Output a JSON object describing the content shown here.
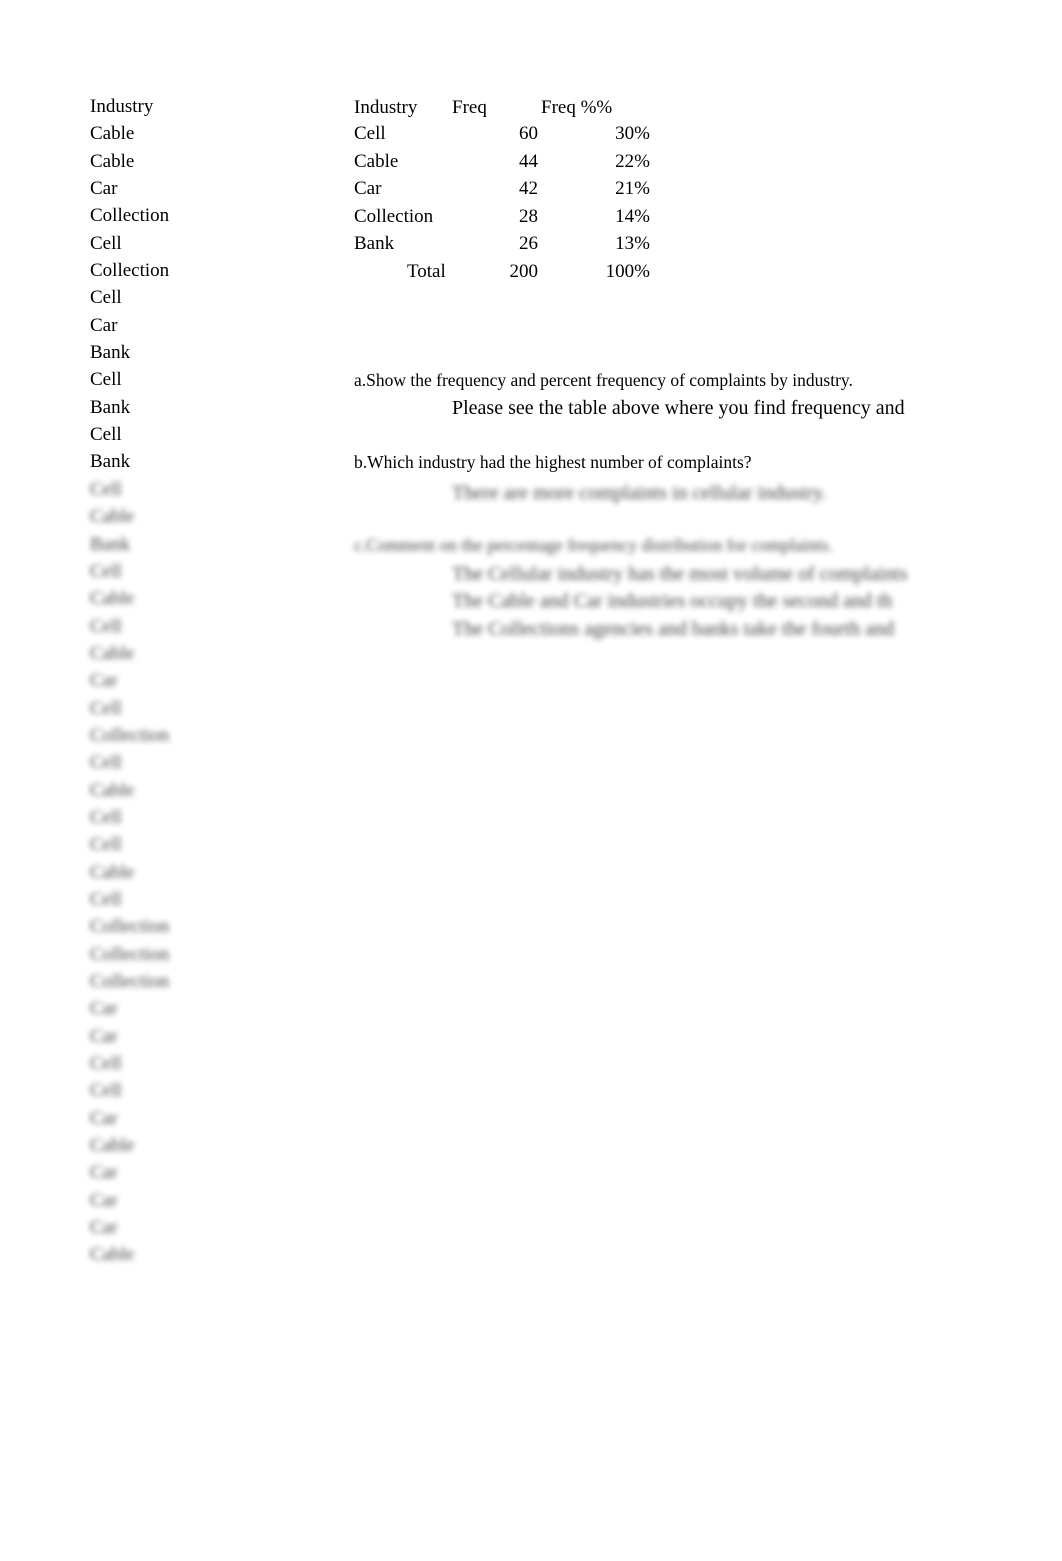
{
  "raw_data": {
    "header": "Industry",
    "visible_items": [
      "Cable",
      "Cable",
      "Car",
      "Collection",
      "Cell",
      "Collection",
      "Cell",
      "Car",
      "Bank",
      "Cell",
      "Bank",
      "Cell",
      "Bank"
    ],
    "blurred_items": [
      "Cell",
      "Cable",
      "Bank",
      "Cell",
      "Cable",
      "Cell",
      "Cable",
      "Car",
      "Cell",
      "Collection",
      "Cell",
      "Cable",
      "Cell",
      "Cell",
      "Cable",
      "Cell",
      "Collection",
      "Collection",
      "Collection",
      "Car",
      "Car",
      "Cell",
      "Cell",
      "Car",
      "Cable",
      "Car",
      "Car",
      "Car",
      "Cable"
    ]
  },
  "freq_table": {
    "headers": {
      "industry": "Industry",
      "freq": "Freq",
      "pct": "Freq %%"
    },
    "rows": [
      {
        "industry": "Cell",
        "freq": "60",
        "pct": "30%"
      },
      {
        "industry": "Cable",
        "freq": "44",
        "pct": "22%"
      },
      {
        "industry": "Car",
        "freq": "42",
        "pct": "21%"
      },
      {
        "industry": "Collection",
        "freq": "28",
        "pct": "14%"
      },
      {
        "industry": "Bank",
        "freq": "26",
        "pct": "13%"
      }
    ],
    "total": {
      "label": "Total",
      "freq": "200",
      "pct": "100%"
    }
  },
  "questions": {
    "a": "a.Show the frequency and percent frequency of complaints by industry.",
    "a_answer": "Please see the table above where you find frequency and",
    "b": "b.Which industry had the highest number of complaints?",
    "b_answer": "There are more complaints in cellular industry.",
    "c": "c.Comment on the percentage frequency distribution for complaints.",
    "c_answers": [
      "The Cellular industry has the most volume of complaints",
      "The Cable and Car industries occupy the second and th",
      "The Collections agencies and banks take the fourth and"
    ]
  }
}
